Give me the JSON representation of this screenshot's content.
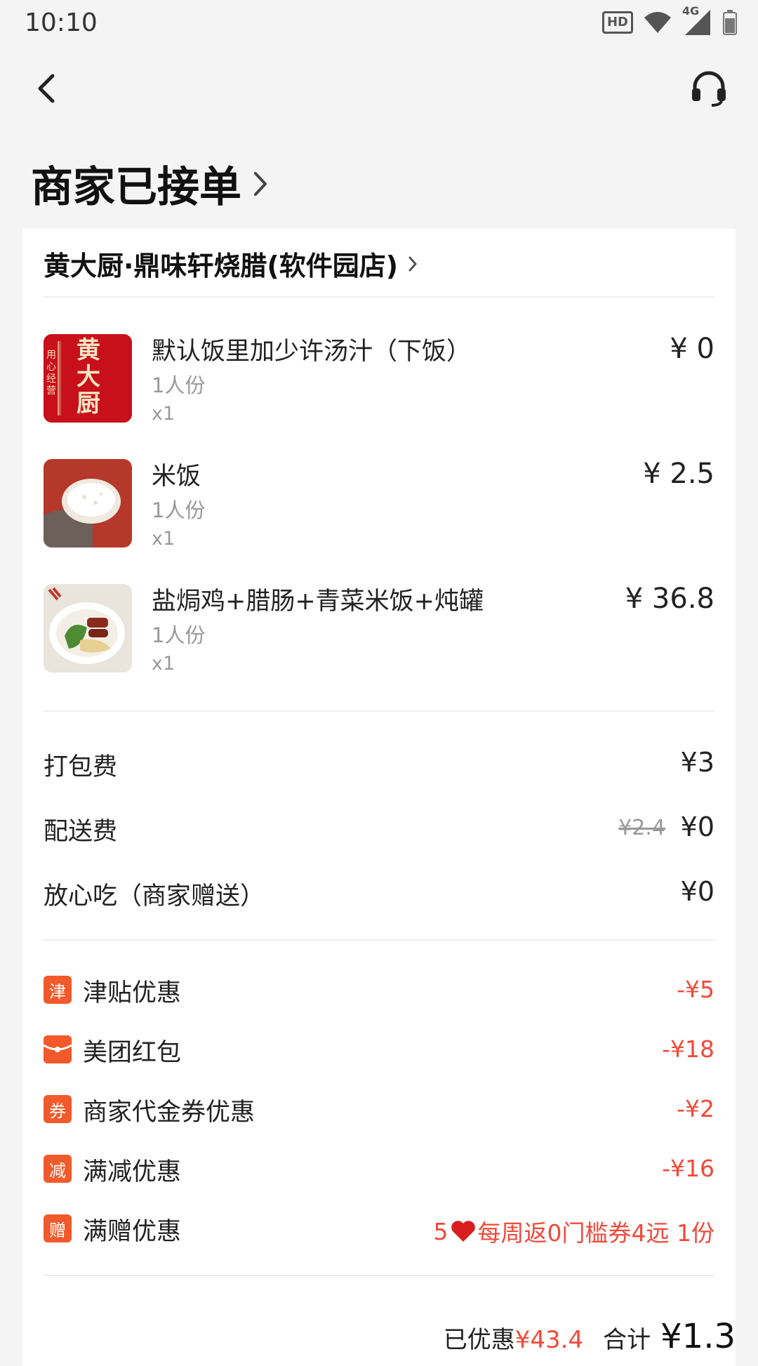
{
  "status_bar": {
    "time": "10:10",
    "hd": "HD",
    "network": "4G"
  },
  "header": {
    "order_status": "商家已接单"
  },
  "shop": {
    "name": "黄大厨·鼎味轩烧腊(软件园店)"
  },
  "items": [
    {
      "name": "默认饭里加少许汤汁（下饭）",
      "spec": "1人份",
      "qty": "x1",
      "price": "¥ 0",
      "thumb_text": "黄大厨",
      "thumb_side_text": "用心经营"
    },
    {
      "name": "米饭",
      "spec": "1人份",
      "qty": "x1",
      "price": "¥ 2.5"
    },
    {
      "name": "盐焗鸡+腊肠+青菜米饭+炖罐",
      "spec": "1人份",
      "qty": "x1",
      "price": "¥ 36.8"
    }
  ],
  "fees": [
    {
      "label": "打包费",
      "value": "¥3"
    },
    {
      "label": "配送费",
      "original": "¥2.4",
      "value": "¥0"
    },
    {
      "label": "放心吃（商家赠送）",
      "value": "¥0"
    }
  ],
  "discounts": [
    {
      "tag": "津",
      "label": "津贴优惠",
      "value": "-¥5"
    },
    {
      "tag": "",
      "label": "美团红包",
      "value": "-¥18",
      "icon": "red-packet-icon"
    },
    {
      "tag": "券",
      "label": "商家代金券优惠",
      "value": "-¥2"
    },
    {
      "tag": "减",
      "label": "满减优惠",
      "value": "-¥16"
    },
    {
      "tag": "赠",
      "label": "满赠优惠",
      "value_prefix": "5",
      "value": "每周返0门槛券4远 1份",
      "icon": "heart-icon"
    }
  ],
  "summary": {
    "saved_label": "已优惠",
    "saved": "¥43.4",
    "total_label": "合计",
    "total": "¥1.3"
  },
  "colors": {
    "accent_red": "#f04a3a",
    "tag_orange": "#f25a2b",
    "brand_red": "#c8101b"
  }
}
